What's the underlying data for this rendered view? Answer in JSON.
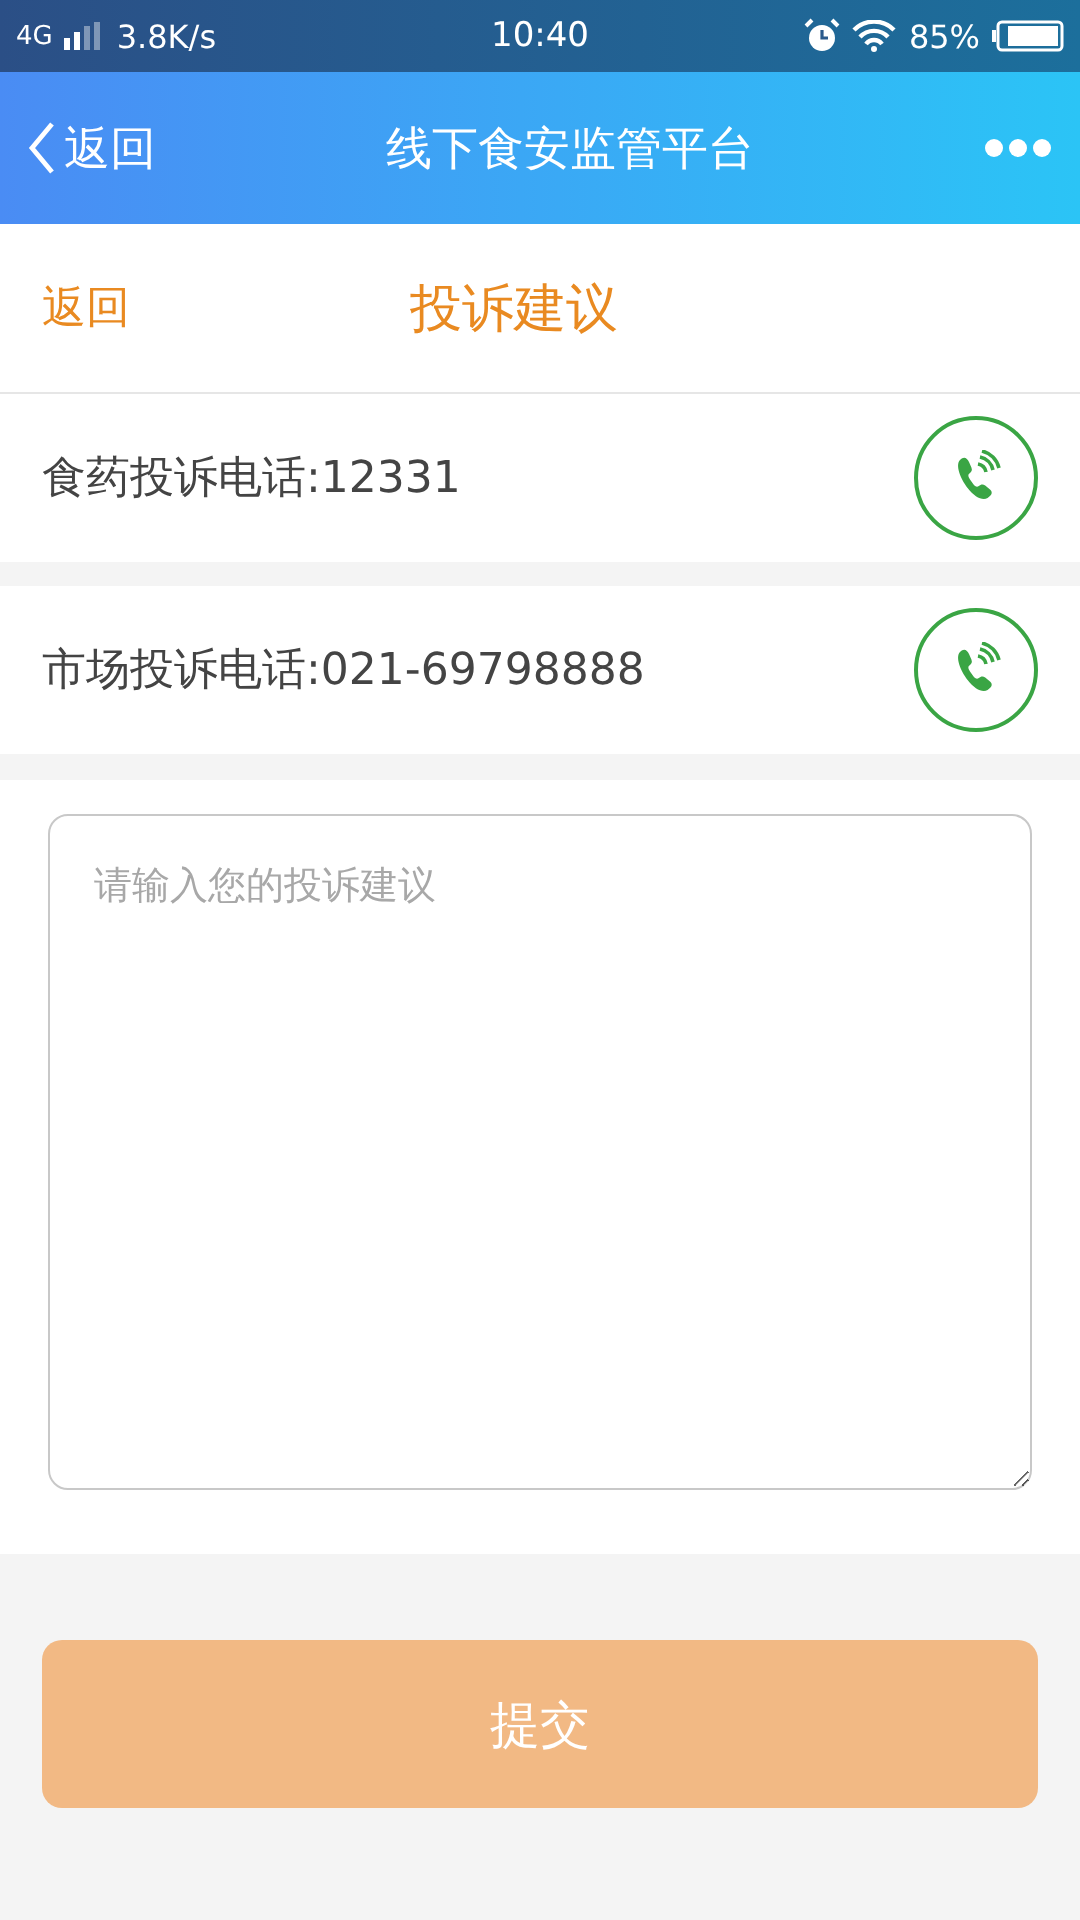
{
  "status_bar": {
    "network": "4G",
    "speed": "3.8K/s",
    "time": "10:40",
    "battery": "85%"
  },
  "nav_bar": {
    "back": "返回",
    "title": "线下食安监管平台"
  },
  "header": {
    "back": "返回",
    "title": "投诉建议"
  },
  "hotlines": [
    {
      "label": "食药投诉电话:12331"
    },
    {
      "label": "市场投诉电话:021-69798888"
    }
  ],
  "complaint_field": {
    "placeholder": "请输入您的投诉建议"
  },
  "submit_button": {
    "label": "提交",
    "disabled": true
  }
}
